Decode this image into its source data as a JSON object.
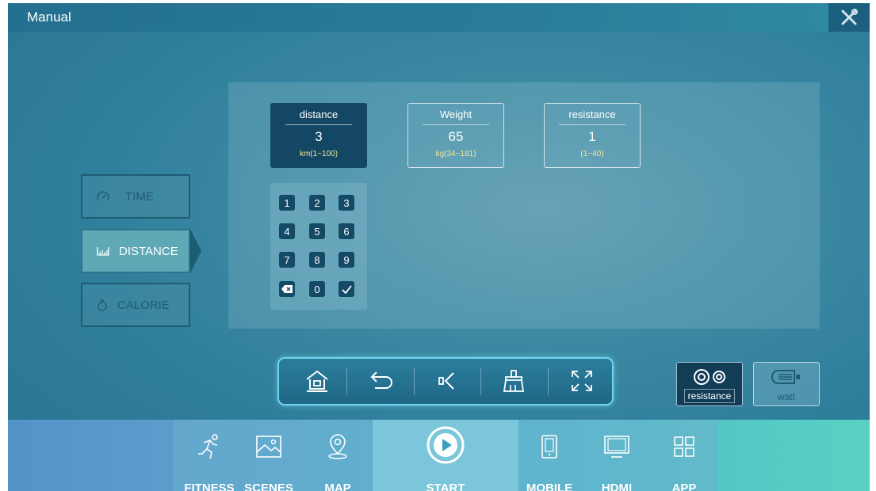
{
  "window": {
    "title": "Manual",
    "close_icon": "tools-close-icon"
  },
  "params": [
    {
      "name": "distance",
      "value": "3",
      "range": "km(1~100)",
      "active": true
    },
    {
      "name": "Weight",
      "value": "65",
      "range": "kg(34~181)",
      "active": false
    },
    {
      "name": "resistance",
      "value": "1",
      "range": "(1~40)",
      "active": false
    }
  ],
  "keypad": {
    "keys": [
      "1",
      "2",
      "3",
      "4",
      "5",
      "6",
      "7",
      "8",
      "9",
      "backspace",
      "0",
      "confirm"
    ]
  },
  "modes": [
    {
      "label": "TIME",
      "icon": "speedometer-icon",
      "active": false
    },
    {
      "label": "DISTANCE",
      "icon": "ruler-icon",
      "active": true
    },
    {
      "label": "CALORIE",
      "icon": "flame-icon",
      "active": false
    }
  ],
  "toolbar": {
    "tools": [
      "home-icon",
      "back-icon",
      "volume-icon",
      "clear-icon",
      "fullscreen-icon"
    ]
  },
  "resistance_watt": {
    "resistance_label": "resistance",
    "watt_label": "watt"
  },
  "nav": {
    "items": [
      {
        "label": "FITNESS",
        "icon": "runner-icon"
      },
      {
        "label": "SCENES",
        "icon": "image-icon"
      },
      {
        "label": "MAP",
        "icon": "location-pin-icon"
      },
      {
        "label": "START",
        "icon": "play-icon"
      },
      {
        "label": "MOBILE",
        "icon": "phone-icon"
      },
      {
        "label": "HDMI",
        "icon": "monitor-icon"
      },
      {
        "label": "APP",
        "icon": "app-grid-icon"
      }
    ]
  },
  "colors": {
    "accent_dark": "#134763",
    "range_text": "#f0e69a",
    "toolbar_glow": "#6fd6ee"
  }
}
